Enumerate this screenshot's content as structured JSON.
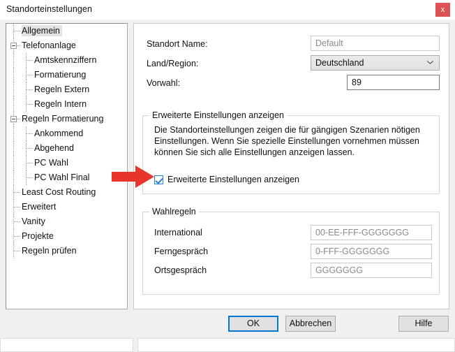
{
  "window": {
    "title": "Standorteinstellungen",
    "close_label": "x",
    "close_color": "#dd5252"
  },
  "tree": {
    "items": [
      {
        "label": "Allgemein",
        "level": 0,
        "selected": true,
        "expander": false
      },
      {
        "label": "Telefonanlage",
        "level": 0,
        "selected": false,
        "expander": true
      },
      {
        "label": "Amtskennziffern",
        "level": 1,
        "selected": false,
        "expander": false
      },
      {
        "label": "Formatierung",
        "level": 1,
        "selected": false,
        "expander": false
      },
      {
        "label": "Regeln Extern",
        "level": 1,
        "selected": false,
        "expander": false
      },
      {
        "label": "Regeln Intern",
        "level": 1,
        "selected": false,
        "expander": false
      },
      {
        "label": "Regeln Formatierung",
        "level": 0,
        "selected": false,
        "expander": true
      },
      {
        "label": "Ankommend",
        "level": 1,
        "selected": false,
        "expander": false
      },
      {
        "label": "Abgehend",
        "level": 1,
        "selected": false,
        "expander": false
      },
      {
        "label": "PC Wahl",
        "level": 1,
        "selected": false,
        "expander": false
      },
      {
        "label": "PC Wahl Final",
        "level": 1,
        "selected": false,
        "expander": false
      },
      {
        "label": "Least Cost Routing",
        "level": 0,
        "selected": false,
        "expander": false
      },
      {
        "label": "Erweitert",
        "level": 0,
        "selected": false,
        "expander": false
      },
      {
        "label": "Vanity",
        "level": 0,
        "selected": false,
        "expander": false
      },
      {
        "label": "Projekte",
        "level": 0,
        "selected": false,
        "expander": false
      },
      {
        "label": "Regeln prüfen",
        "level": 0,
        "selected": false,
        "expander": false
      }
    ]
  },
  "form": {
    "standort_name": {
      "label": "Standort Name:",
      "value": "Default"
    },
    "land_region": {
      "label": "Land/Region:",
      "value": "Deutschland"
    },
    "vorwahl": {
      "label": "Vorwahl:",
      "value": "89"
    }
  },
  "advanced_group": {
    "title": "Erweiterte Einstellungen anzeigen",
    "description": "Die Standorteinstellungen zeigen die für gängigen Szenarien nötigen Einstellungen. Wenn Sie spezielle Einstellungen vornehmen müssen können Sie sich alle Einstellungen anzeigen lassen.",
    "checkbox_label": "Erweiterte Einstellungen anzeigen",
    "checkbox_checked": true,
    "checkbox_accent": "#2a7fd4"
  },
  "dial_rules_group": {
    "title": "Wahlregeln",
    "rows": [
      {
        "label": "International",
        "value": "00-EE-FFF-GGGGGGG"
      },
      {
        "label": "Ferngespräch",
        "value": "0-FFF-GGGGGGG"
      },
      {
        "label": "Ortsgespräch",
        "value": "GGGGGGG"
      }
    ]
  },
  "buttons": {
    "ok": "OK",
    "cancel": "Abbrechen",
    "help": "Hilfe",
    "default_focus_color": "#0078d7"
  },
  "annotation": {
    "arrow_color": "#e8342a",
    "points_to": "Erweiterte Einstellungen anzeigen"
  }
}
